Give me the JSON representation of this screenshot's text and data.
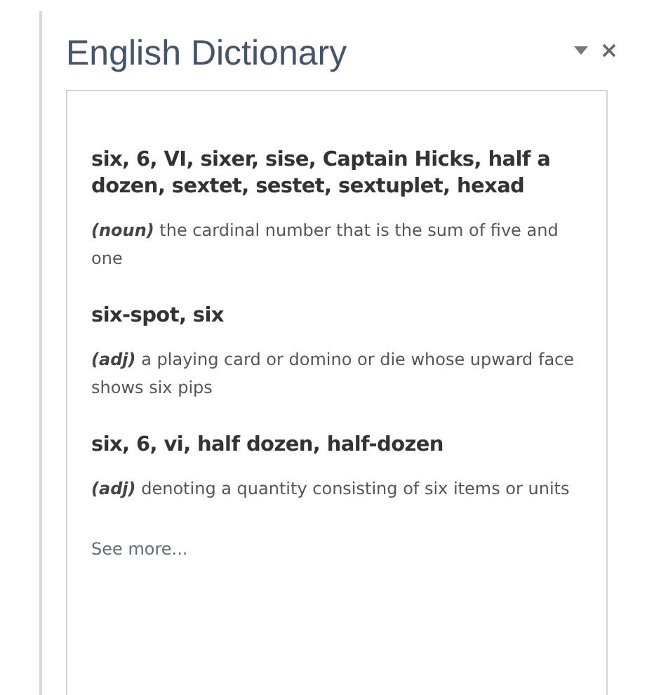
{
  "pane": {
    "title": "English Dictionary"
  },
  "entries": [
    {
      "headword": "six, 6, VI, sixer, sise, Captain Hicks, half a dozen, sextet, sestet, sextuplet, hexad",
      "pos": "(noun)",
      "definition": "the cardinal number that is the sum of five and one"
    },
    {
      "headword": "six-spot, six",
      "pos": "(adj)",
      "definition": "a playing card or domino or die whose upward face shows six pips"
    },
    {
      "headword": "six, 6, vi, half dozen, half-dozen",
      "pos": "(adj)",
      "definition": "denoting a quantity consisting of six items or units"
    }
  ],
  "see_more": "See more..."
}
